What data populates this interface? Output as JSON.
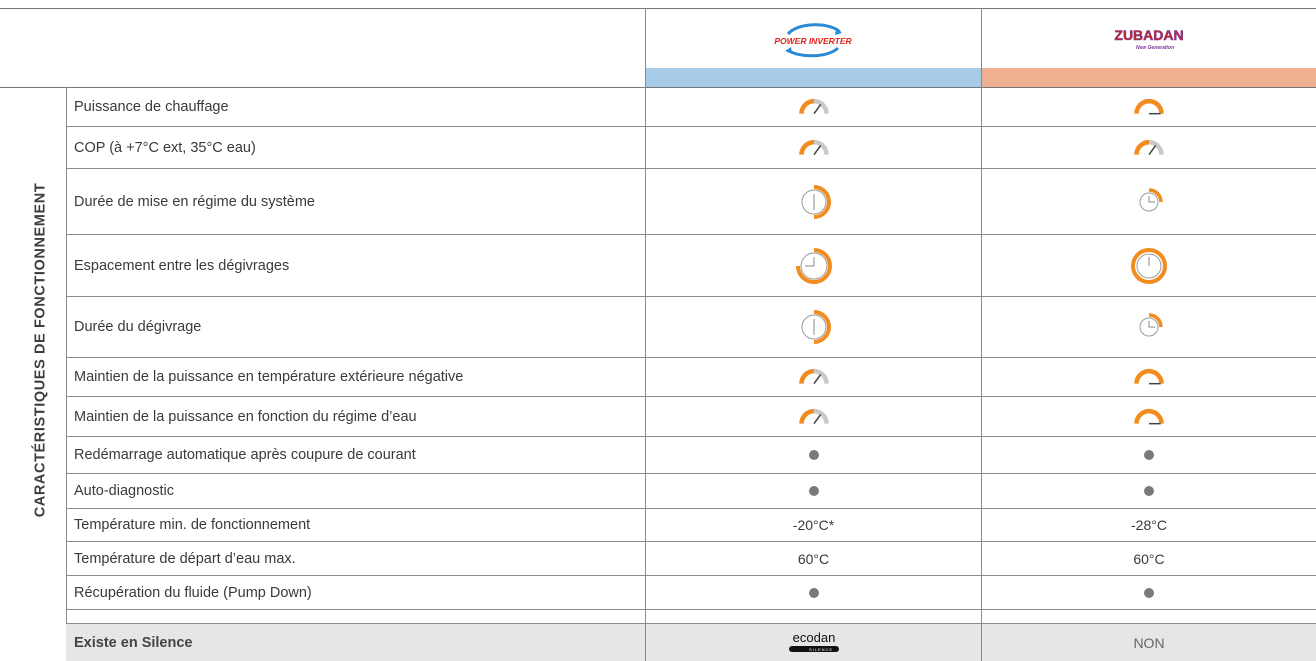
{
  "section_title": "CARACTÉRISTIQUES DE FONCTIONNEMENT",
  "columns": {
    "power_inverter": {
      "logo_text": "POWER INVERTER",
      "color": "#a8cbe8"
    },
    "zubadan": {
      "logo_text": "ZUBADAN",
      "logo_subtext": "New Generation",
      "color": "#eeb090"
    }
  },
  "colors": {
    "orange": "#f28c1e",
    "gray_dot": "#7a7a7a",
    "shade": "#e6e6e6",
    "line": "#8a8a8a"
  },
  "rows": [
    {
      "label": "Puissance de chauffage",
      "power": "gauge-medium-icon",
      "zubadan": "gauge-max-icon"
    },
    {
      "label": "COP (à +7°C ext, 35°C eau)",
      "power": "gauge-medium-icon",
      "zubadan": "gauge-medium-icon"
    },
    {
      "label": "Durée de mise en régime du système",
      "power": "clock-half-icon",
      "zubadan": "clock-quarter-icon"
    },
    {
      "label": "Espacement entre les dégivrages",
      "power": "clock-three-quarter-icon",
      "zubadan": "clock-full-icon"
    },
    {
      "label": "Durée du dégivrage",
      "power": "clock-half-icon",
      "zubadan": "clock-quarter-icon"
    },
    {
      "label": "Maintien de la puissance en température extérieure négative",
      "power": "gauge-medium-icon",
      "zubadan": "gauge-max-icon"
    },
    {
      "label": "Maintien de la puissance en fonction du régime d’eau",
      "power": "gauge-medium-icon",
      "zubadan": "gauge-max-icon"
    },
    {
      "label": "Redémarrage automatique après coupure de courant",
      "power": "dot-icon",
      "zubadan": "dot-icon"
    },
    {
      "label": "Auto-diagnostic",
      "power": "dot-icon",
      "zubadan": "dot-icon"
    },
    {
      "label": "Température min. de fonctionnement",
      "power": "-20°C*",
      "zubadan": "-28°C"
    },
    {
      "label": "Température de départ d’eau max.",
      "power": "60°C",
      "zubadan": "60°C"
    },
    {
      "label": "Récupération du fluide (Pump Down)",
      "power": "dot-icon",
      "zubadan": "dot-icon"
    }
  ],
  "footer_row": {
    "label": "Existe en Silence",
    "power_logo": "ecodan",
    "power_logo_sub": "SILENCE",
    "zubadan": "NON"
  }
}
